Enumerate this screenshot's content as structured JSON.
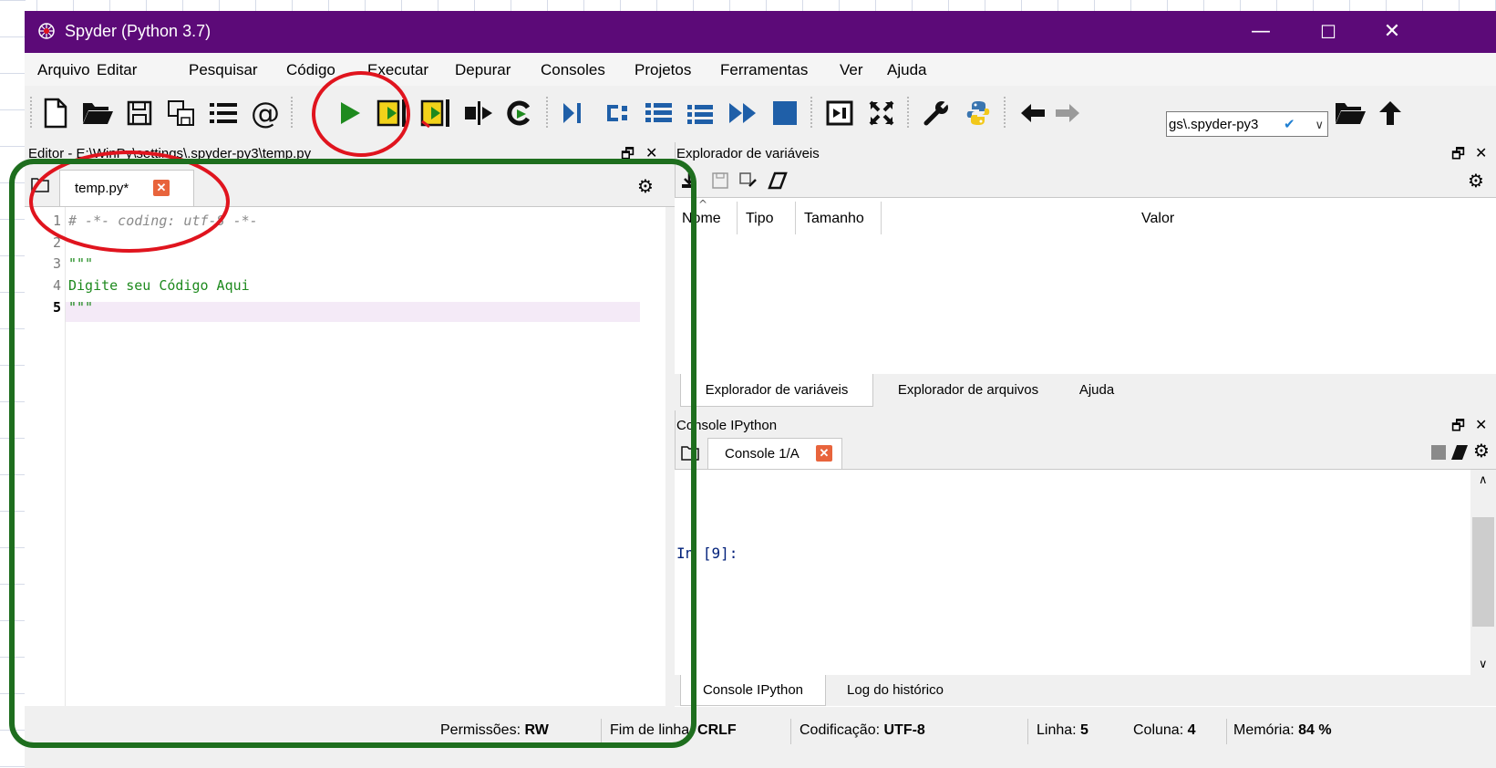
{
  "window": {
    "title": "Spyder (Python 3.7)",
    "minimize": "—",
    "maximize": "☐",
    "close": "✕"
  },
  "menu": [
    "Arquivo",
    "Editar",
    "Pesquisar",
    "Código",
    "Executar",
    "Depurar",
    "Consoles",
    "Projetos",
    "Ferramentas",
    "Ver",
    "Ajuda"
  ],
  "toolbar": {
    "icons": [
      "new-file-icon",
      "open-folder-icon",
      "save-icon",
      "save-all-icon",
      "outline-list-icon",
      "at-symbol-icon",
      "run-icon",
      "run-cell-icon",
      "run-cell-advance-icon",
      "run-selection-icon",
      "rerun-icon",
      "debug-icon",
      "step-icon",
      "step-into-icon",
      "step-return-icon",
      "continue-icon",
      "stop-icon",
      "maximize-pane-icon",
      "fullscreen-icon",
      "preferences-icon",
      "python-path-icon",
      "back-arrow-icon",
      "forward-arrow-icon",
      "browse-folder-icon",
      "parent-dir-icon"
    ],
    "path_value": "gs\\.spyder-py3"
  },
  "editor": {
    "header": "Editor - E:\\WinPy\\settings\\.spyder-py3\\temp.py",
    "tab_label": "temp.py*",
    "lines": [
      {
        "num": "1",
        "text": "# -*- coding: utf-8 -*-"
      },
      {
        "num": "2",
        "text": ""
      },
      {
        "num": "3",
        "text": "\"\"\""
      },
      {
        "num": "4",
        "text": "Digite seu Código Aqui"
      },
      {
        "num": "5",
        "text": "\"\"\""
      }
    ],
    "colors": {
      "comment": "#8a8a8a",
      "string": "#1e8a1e",
      "current_line": "#f4eaf7"
    }
  },
  "variable_explorer": {
    "header": "Explorador de variáveis",
    "columns": [
      "Nome",
      "Tipo",
      "Tamanho",
      "Valor"
    ],
    "tabs": [
      "Explorador de variáveis",
      "Explorador de arquivos",
      "Ajuda"
    ]
  },
  "console": {
    "header": "Console IPython",
    "tab_label": "Console 1/A",
    "prompt": "In [9]:",
    "tabs": [
      "Console IPython",
      "Log do histórico"
    ]
  },
  "status": {
    "permissions_label": "Permissões:",
    "permissions_value": "RW",
    "eol_label": "Fim de linha:",
    "eol_value": "CRLF",
    "encoding_label": "Codificação:",
    "encoding_value": "UTF-8",
    "line_label": "Linha:",
    "line_value": "5",
    "col_label": "Coluna:",
    "col_value": "4",
    "mem_label": "Memória:",
    "mem_value": "84 %"
  },
  "annotation_colors": {
    "circle": "#e0141e",
    "box": "#1e6e1e"
  }
}
